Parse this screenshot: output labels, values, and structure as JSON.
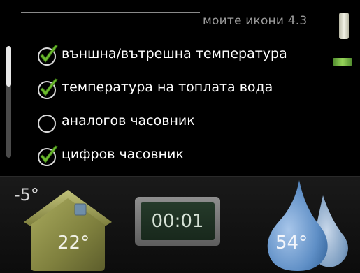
{
  "menu": {
    "title": "моите икони 4.3",
    "scroll_position": 0.0,
    "items": [
      {
        "label": "външна/вътрешна температура",
        "checked": true
      },
      {
        "label": "температура на топлата вода",
        "checked": true
      },
      {
        "label": "аналогов часовник",
        "checked": false
      },
      {
        "label": "цифров часовник",
        "checked": true
      }
    ]
  },
  "status": {
    "outdoor_temp": "-5°",
    "indoor_temp": "22°",
    "clock": "00:01",
    "hot_water_temp": "54°"
  },
  "icons": {
    "check": "checkmark-icon",
    "house": "house-icon",
    "drops": "water-drop-icon"
  },
  "colors": {
    "checked_green": "#6dbb2f",
    "text": "#ffffff",
    "title": "#9c9c9c",
    "house": "#8a8b45",
    "water": "#6e9ed1"
  }
}
